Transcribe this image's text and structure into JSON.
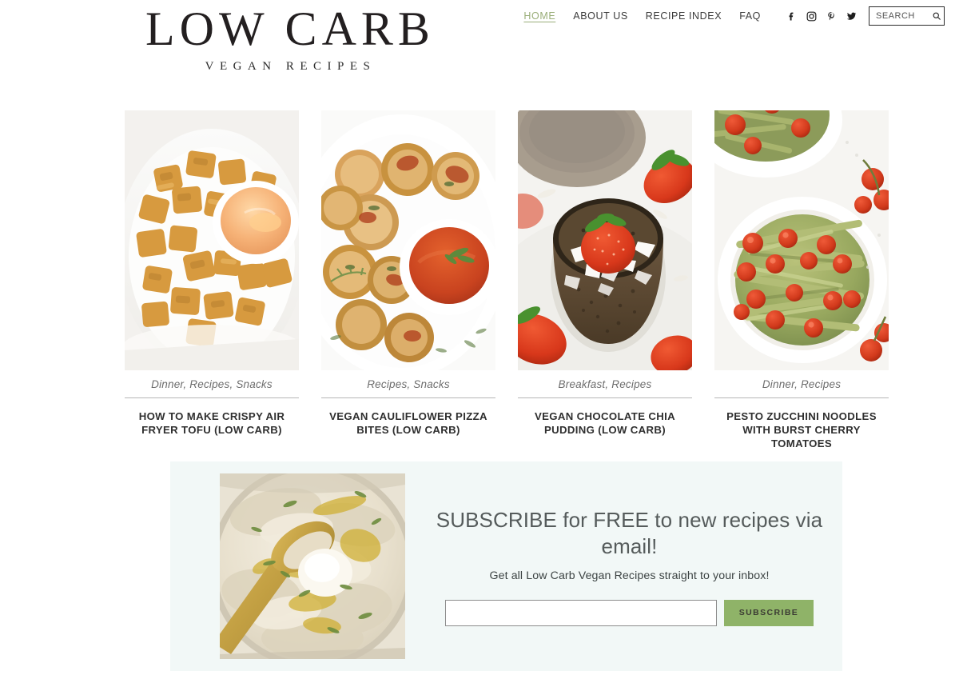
{
  "site": {
    "logo_main": "LOW CARB",
    "logo_sub": "VEGAN RECIPES"
  },
  "nav": {
    "links": [
      {
        "label": "HOME",
        "active": true
      },
      {
        "label": "ABOUT US",
        "active": false
      },
      {
        "label": "RECIPE INDEX",
        "active": false
      },
      {
        "label": "FAQ",
        "active": false
      }
    ],
    "socials": [
      {
        "name": "facebook-icon",
        "label": "Facebook"
      },
      {
        "name": "instagram-icon",
        "label": "Instagram"
      },
      {
        "name": "pinterest-icon",
        "label": "Pinterest"
      },
      {
        "name": "twitter-icon",
        "label": "Twitter"
      }
    ],
    "search": {
      "placeholder": "SEARCH",
      "value": ""
    },
    "active_link_color": "#9aae79"
  },
  "recipes": [
    {
      "categories": "Dinner, Recipes, Snacks",
      "title": "HOW TO MAKE CRISPY AIR FRYER TOFU (LOW CARB)",
      "image_alt": "Crispy air fryer tofu cubes on a white plate with orange dipping sauce"
    },
    {
      "categories": "Recipes, Snacks",
      "title": "VEGAN CAULIFLOWER PIZZA BITES (LOW CARB)",
      "image_alt": "Cauliflower pizza bites with marinara dipping sauce and thyme"
    },
    {
      "categories": "Breakfast, Recipes",
      "title": "VEGAN CHOCOLATE CHIA PUDDING (LOW CARB)",
      "image_alt": "Chocolate chia pudding in a glass topped with a strawberry and coconut flakes"
    },
    {
      "categories": "Dinner, Recipes",
      "title": "PESTO ZUCCHINI NOODLES WITH BURST CHERRY TOMATOES",
      "image_alt": "Pesto zucchini noodles with burst cherry tomatoes in a white bowl"
    }
  ],
  "subscribe": {
    "heading": "SUBSCRIBE for FREE to new recipes via email!",
    "subtext": "Get all Low Carb Vegan Recipes straight to your inbox!",
    "email_placeholder": "",
    "email_value": "",
    "button_label": "SUBSCRIBE",
    "button_color": "#8fb368",
    "panel_color": "#f2f8f7",
    "image_alt": "Bowl of mashed cauliflower with olive oil, herbs and a gold spoon"
  }
}
